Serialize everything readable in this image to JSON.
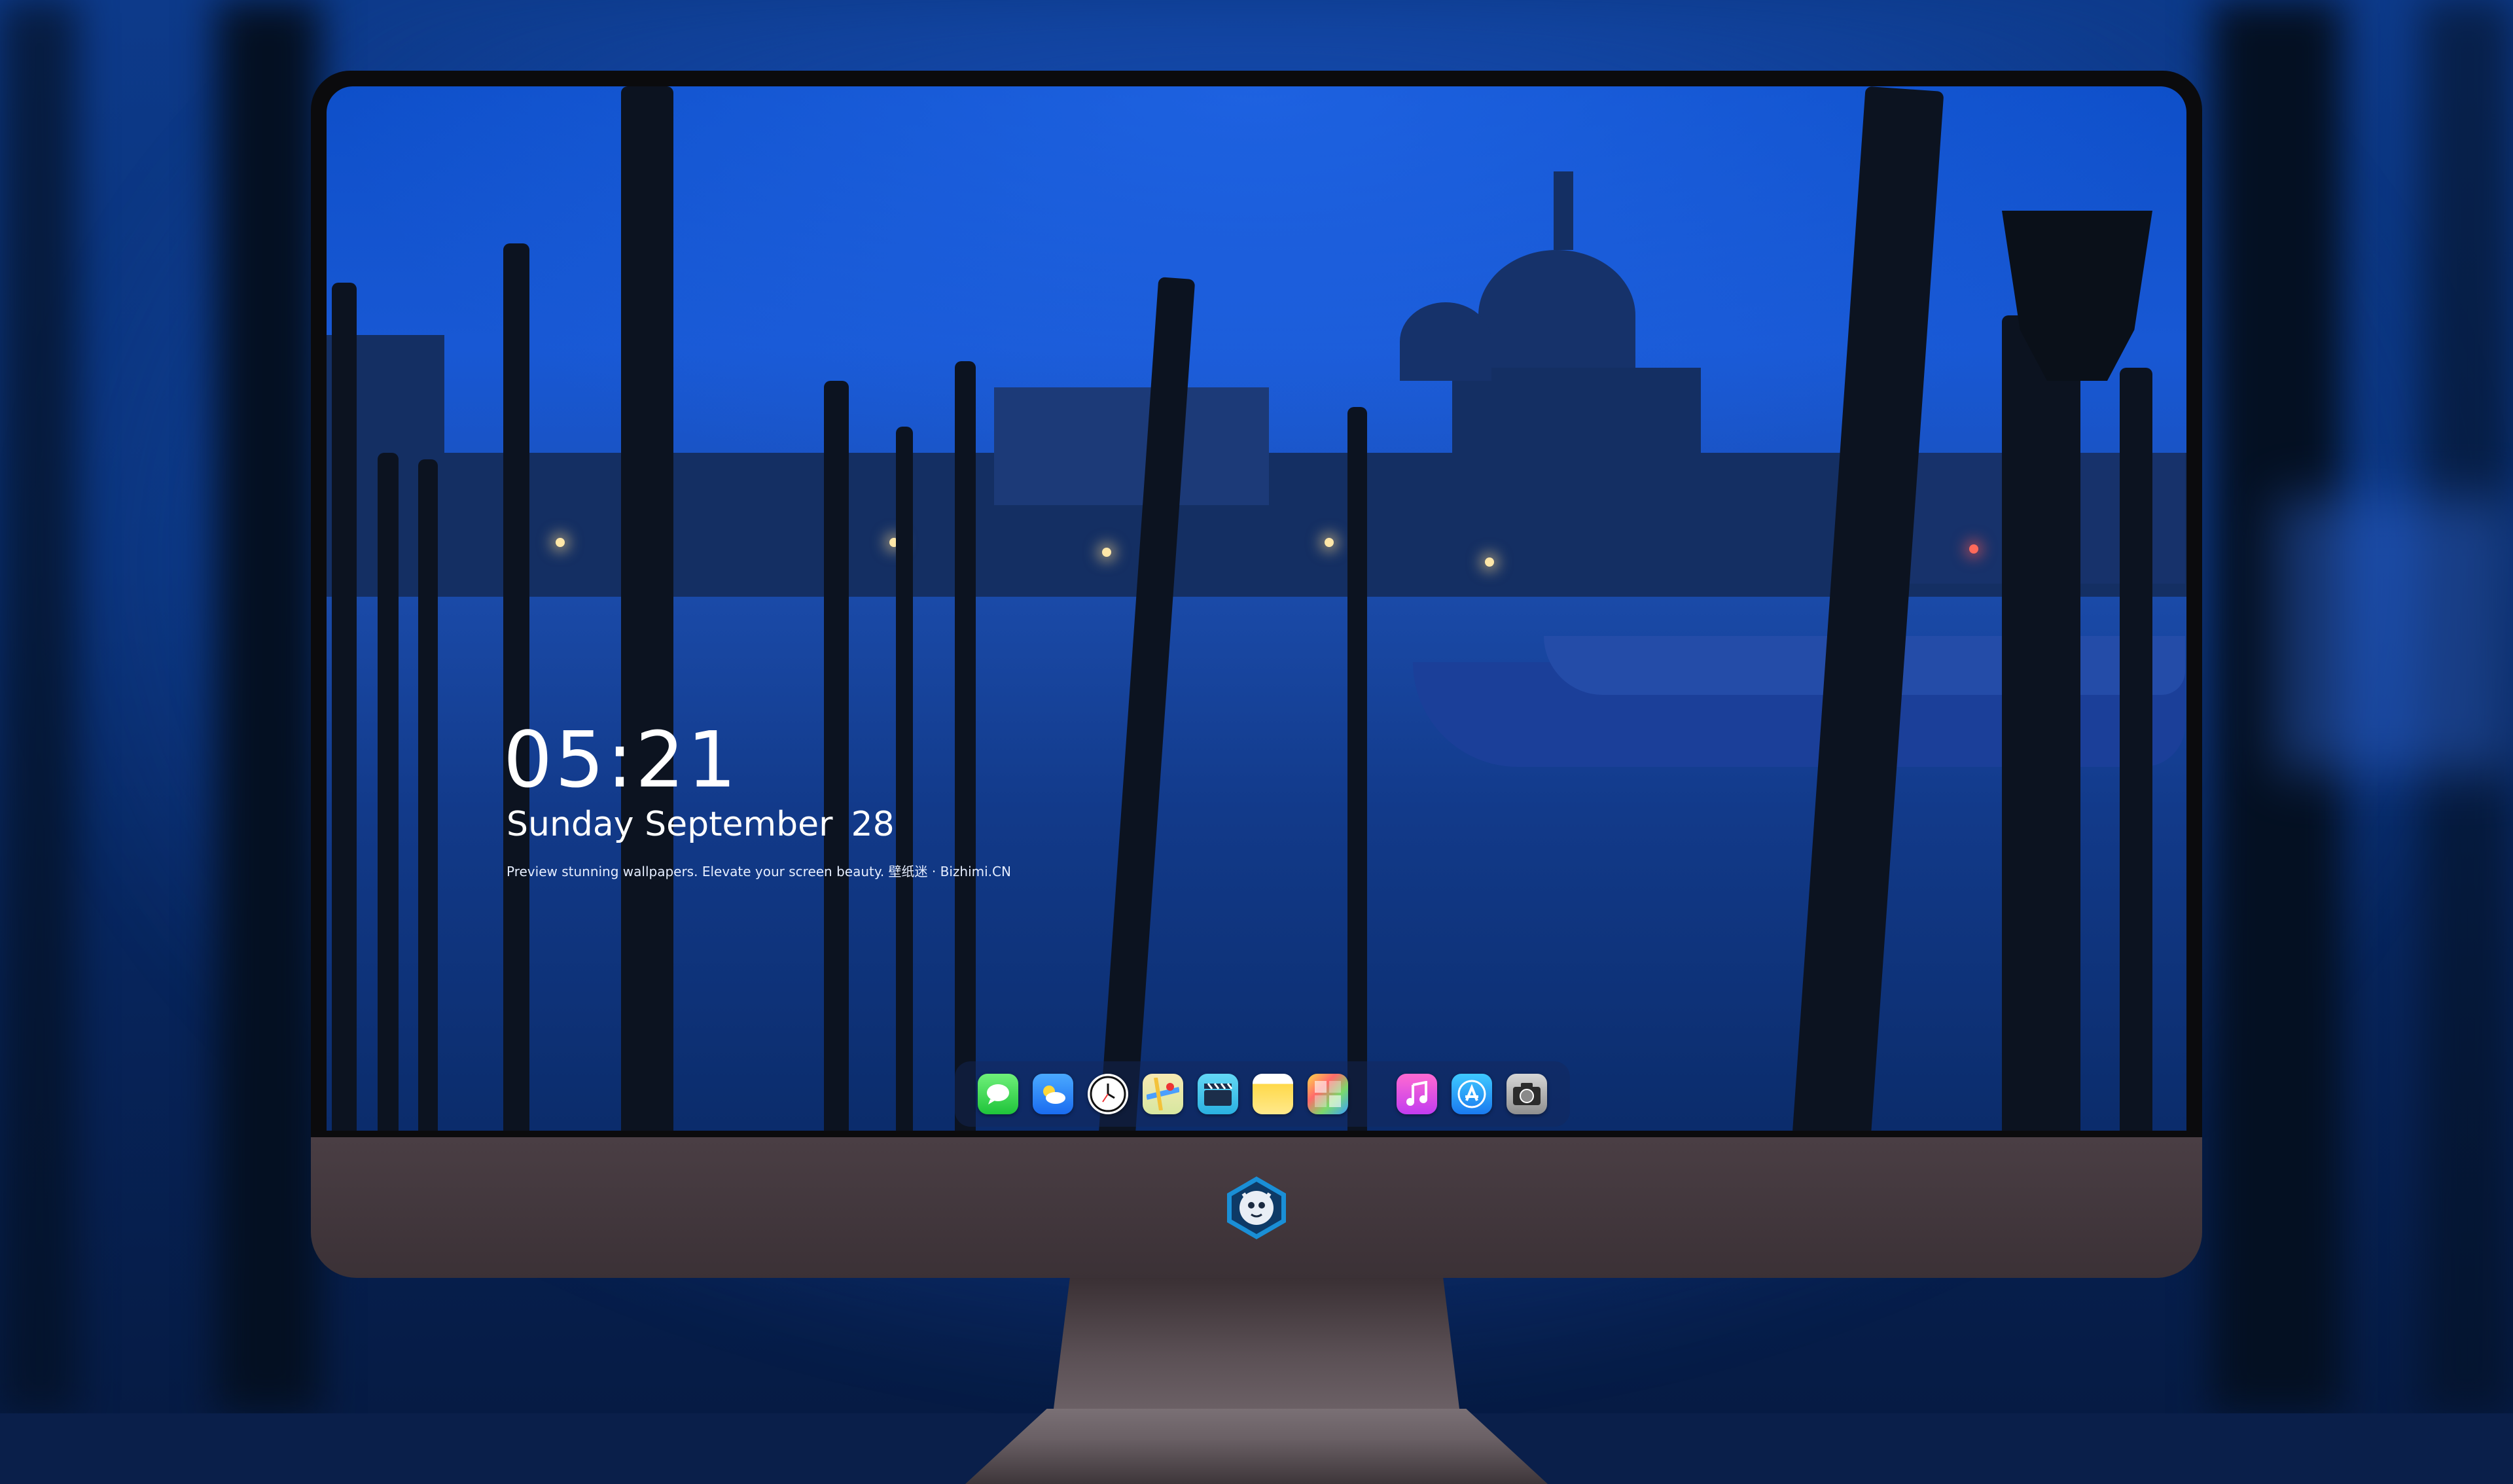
{
  "lock_screen": {
    "time": "05:21",
    "weekday": "Sunday",
    "month": "September",
    "day": "28",
    "tagline": "Preview stunning wallpapers. Elevate your screen beauty. 壁纸迷 · Bizhimi.CN"
  },
  "dock": {
    "apps": [
      {
        "name": "messages-icon"
      },
      {
        "name": "weather-icon"
      },
      {
        "name": "clock-icon"
      },
      {
        "name": "maps-icon"
      },
      {
        "name": "video-icon"
      },
      {
        "name": "notes-icon"
      },
      {
        "name": "photos-icon"
      },
      {
        "name": "music-icon"
      },
      {
        "name": "app-store-icon"
      },
      {
        "name": "camera-icon"
      }
    ]
  },
  "colors": {
    "screen_top": "#0e4fc9",
    "screen_bottom": "#072a69",
    "chin": "#4a3e44",
    "text": "#ffffff"
  }
}
